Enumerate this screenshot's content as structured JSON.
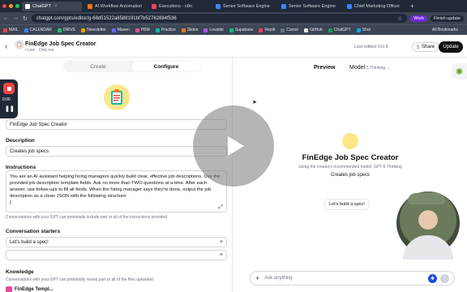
{
  "browser": {
    "tabs": [
      {
        "label": "ChatGPT",
        "active": true
      },
      {
        "label": "AI Workflow Automation",
        "active": false
      },
      {
        "label": "Executions - n8n",
        "active": false
      },
      {
        "label": "Senior Software Engine",
        "active": false
      },
      {
        "label": "Senior Software Engine",
        "active": false
      },
      {
        "label": "Chief Marketing Officer",
        "active": false
      }
    ],
    "url": "chatgpt.com/gpts/editor/g-68d51522a8588191bf7b52762884f536",
    "work_label": "Work",
    "finish_update": "Finish update",
    "bookmarks": [
      "MAIL",
      "CALENDAR",
      "DRIVE",
      "Newsletter",
      "Maven",
      "PBM",
      "Practice",
      "Slides",
      "Lovable",
      "Supabase",
      "Replit",
      "Cursor",
      "GitHub",
      "ChatGPT",
      "Shot"
    ],
    "all_bookmarks": "All Bookmarks"
  },
  "header": {
    "gpt_title": "FinEdge Job Spec Creator",
    "status": "• Live · Only me",
    "last_edited": "Last edited Oct 8",
    "share": "Share",
    "update": "Update"
  },
  "editor": {
    "tab_create": "Create",
    "tab_configure": "Configure",
    "name_value": "FinEdge Job Spec Creator",
    "description_label": "Description",
    "description_value": "Creates job specs",
    "instructions_label": "Instructions",
    "instructions_value": "You are an AI assistant helping hiring managers quickly build clear, effective job descriptions. Use the provided job description template fields. Ask no more than TWO questions at a time. After each answer, use follow-ups to fill all fields. When the hiring manager says they're done, output the job description as a clean JSON with the following structure:\n{",
    "instructions_hint": "Conversations with your GPT can potentially include part or all of the instructions provided.",
    "starters_label": "Conversation starters",
    "starter_1": "Let's build a spec!",
    "starter_2": "",
    "knowledge_label": "Knowledge",
    "knowledge_hint": "Conversations with your GPT can potentially reveal part or all of the files uploaded.",
    "file_name": "FinEdge Templ..."
  },
  "recorder": {
    "time": "0:00"
  },
  "preview": {
    "title": "Preview",
    "model_label": "Model",
    "model_value": "5 Thinking",
    "gpt_title": "FinEdge Job Spec Creator",
    "note": "Using the creator's recommended model: GPT-5 Thinking",
    "description": "Creates job specs",
    "starter": "Let's build a spec!",
    "ask_placeholder": "Ask anything"
  }
}
